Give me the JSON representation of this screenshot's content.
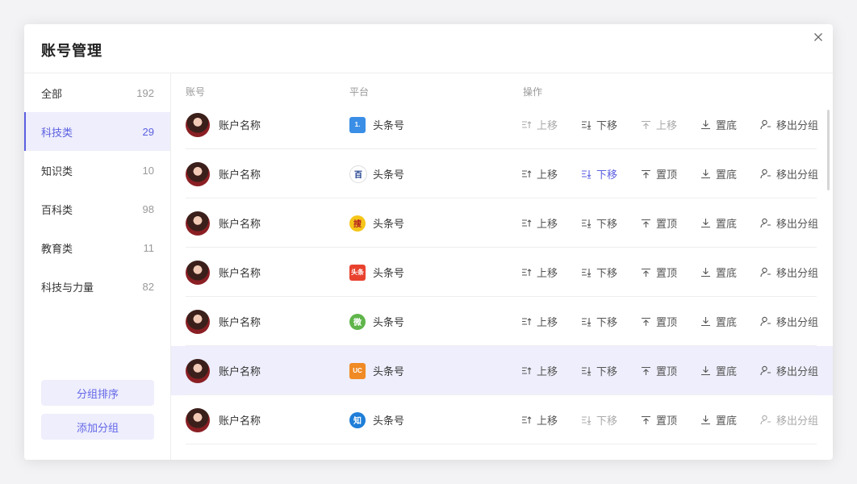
{
  "dialog": {
    "title": "账号管理"
  },
  "sidebar": {
    "items": [
      {
        "label": "全部",
        "count": "192"
      },
      {
        "label": "科技类",
        "count": "29"
      },
      {
        "label": "知识类",
        "count": "10"
      },
      {
        "label": "百科类",
        "count": "98"
      },
      {
        "label": "教育类",
        "count": "11"
      },
      {
        "label": "科技与力量",
        "count": "82"
      }
    ],
    "active_index": 1,
    "sort_button": "分组排序",
    "add_button": "添加分组"
  },
  "table": {
    "headers": {
      "account": "账号",
      "platform": "平台",
      "ops": "操作"
    },
    "op_labels": {
      "up": "上移",
      "down": "下移",
      "top": "置顶",
      "bottom": "置底",
      "remove": "移出分组"
    },
    "rows": [
      {
        "account": "账户名称",
        "platform": "头条号",
        "platform_icon": "1.",
        "icon_color": "#3a8ee6",
        "top_label": "上移"
      },
      {
        "account": "账户名称",
        "platform": "头条号",
        "platform_icon": "百",
        "icon_color": "#ffffff",
        "top_label": "置顶"
      },
      {
        "account": "账户名称",
        "platform": "头条号",
        "platform_icon": "搜",
        "icon_color": "#f5c518",
        "top_label": "置顶"
      },
      {
        "account": "账户名称",
        "platform": "头条号",
        "platform_icon": "头条",
        "icon_color": "#e8422f",
        "top_label": "置顶"
      },
      {
        "account": "账户名称",
        "platform": "头条号",
        "platform_icon": "微",
        "icon_color": "#5fb54a",
        "top_label": "置顶"
      },
      {
        "account": "账户名称",
        "platform": "头条号",
        "platform_icon": "UC",
        "icon_color": "#f08a24",
        "top_label": "置顶"
      },
      {
        "account": "账户名称",
        "platform": "头条号",
        "platform_icon": "知",
        "icon_color": "#1e7ed8",
        "top_label": "置顶"
      }
    ]
  },
  "colors": {
    "accent": "#5b5fe0",
    "highlight": "#eeeefc"
  }
}
